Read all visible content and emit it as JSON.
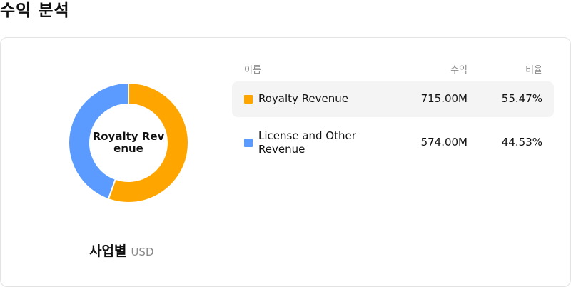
{
  "page": {
    "title": "수익 분석"
  },
  "chart_data": {
    "type": "pie",
    "center_label": "Royalty Revenue",
    "slices": [
      {
        "name": "Royalty Revenue",
        "value": 715.0,
        "percent": 55.47,
        "color": "#ffa500"
      },
      {
        "name": "License and Other Revenue",
        "value": 574.0,
        "percent": 44.53,
        "color": "#5b9bff"
      }
    ]
  },
  "caption": {
    "main": "사업별",
    "unit": "USD"
  },
  "table": {
    "headers": {
      "name": "이름",
      "revenue": "수익",
      "ratio": "비율"
    },
    "rows": [
      {
        "name": "Royalty Revenue",
        "revenue": "715.00M",
        "ratio": "55.47%",
        "color": "#ffa500"
      },
      {
        "name": "License and Other Revenue",
        "revenue": "574.00M",
        "ratio": "44.53%",
        "color": "#5b9bff"
      }
    ]
  }
}
